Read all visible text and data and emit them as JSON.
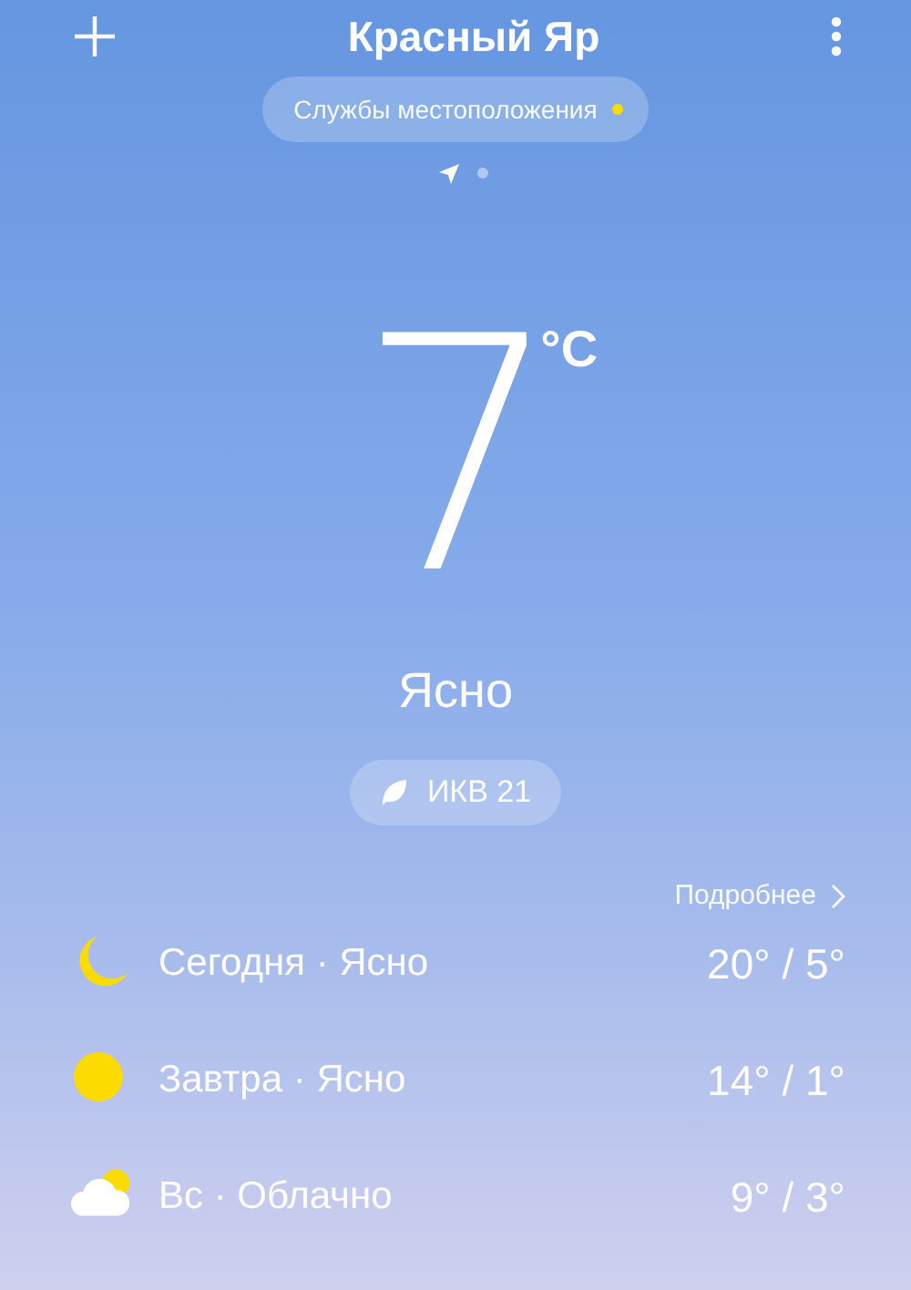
{
  "header": {
    "title": "Красный Яр"
  },
  "location_pill": {
    "label": "Службы местоположения"
  },
  "pages": [
    {
      "kind": "location",
      "selected": true
    },
    {
      "kind": "dot",
      "selected": false
    }
  ],
  "current": {
    "temperature": "7",
    "unit": "°C",
    "condition": "Ясно"
  },
  "aqi": {
    "label": "ИКВ 21"
  },
  "more_link": {
    "label": "Подробнее"
  },
  "forecast": [
    {
      "kind": "moon",
      "label": "Сегодня · Ясно",
      "temps": "20° / 5°"
    },
    {
      "kind": "sun",
      "label": "Завтра · Ясно",
      "temps": "14° / 1°"
    },
    {
      "kind": "cloud-sun",
      "label": "Вс · Облачно",
      "temps": "9° / 3°"
    }
  ]
}
